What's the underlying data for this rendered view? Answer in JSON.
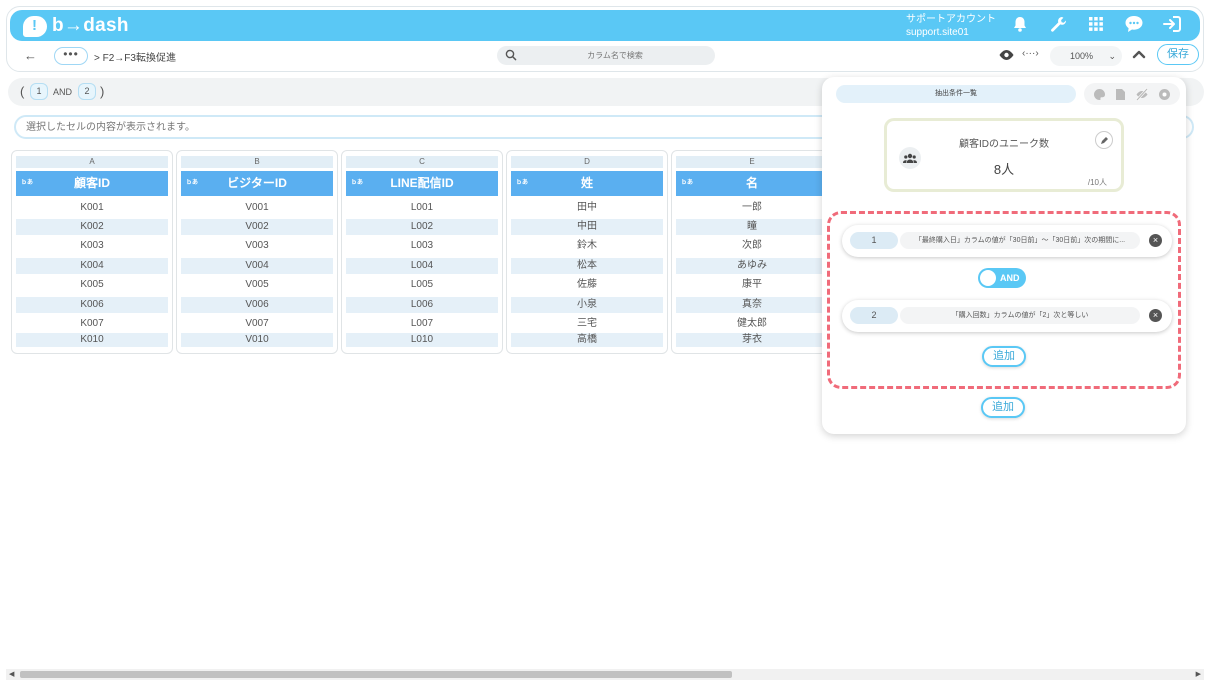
{
  "header": {
    "brand": "b→dash",
    "account_line1": "サポートアカウント",
    "account_line2": "support.site01",
    "icons": [
      "bell-icon",
      "wrench-icon",
      "grid-icon",
      "chat-icon",
      "logout-icon"
    ]
  },
  "toolbar": {
    "back": "←",
    "more": "•••",
    "breadcrumb": "> F2→F3転換促進",
    "search_placeholder": "カラム名で検索",
    "code_icon": "‹···›",
    "zoom": "100%",
    "save_label": "保存"
  },
  "conditions_bar": {
    "open": "(",
    "close": ")",
    "first": "1",
    "operator": "AND",
    "second": "2"
  },
  "cell_input_placeholder": "選択したセルの内容が表示されます。",
  "grid": {
    "type_badge": "ｂあ",
    "columns": [
      {
        "letter": "A",
        "header": "顧客ID",
        "cells": [
          "K001",
          "K002",
          "K003",
          "K004",
          "K005",
          "K006",
          "K007",
          "K010"
        ]
      },
      {
        "letter": "B",
        "header": "ビジターID",
        "cells": [
          "V001",
          "V002",
          "V003",
          "V004",
          "V005",
          "V006",
          "V007",
          "V010"
        ]
      },
      {
        "letter": "C",
        "header": "LINE配信ID",
        "cells": [
          "L001",
          "L002",
          "L003",
          "L004",
          "L005",
          "L006",
          "L007",
          "L010"
        ]
      },
      {
        "letter": "D",
        "header": "姓",
        "cells": [
          "田中",
          "中田",
          "鈴木",
          "松本",
          "佐藤",
          "小泉",
          "三宅",
          "高橋"
        ]
      },
      {
        "letter": "E",
        "header": "名",
        "cells": [
          "一郎",
          "瞳",
          "次郎",
          "あゆみ",
          "康平",
          "真奈",
          "健太郎",
          "芽衣"
        ]
      }
    ]
  },
  "panel": {
    "title": "抽出条件一覧",
    "summary_label": "顧客IDのユニーク数",
    "summary_value": "8人",
    "summary_total": "/10人",
    "conditions": [
      {
        "num": "1",
        "text": "「最終購入日」カラムの値が「30日前」～「30日前」次の期間に..."
      },
      {
        "num": "2",
        "text": "「購入回数」カラムの値が「2」次と等しい"
      }
    ],
    "toggle_label": "AND",
    "add_inner": "追加",
    "add_outer": "追加"
  },
  "colors": {
    "brand": "#5ac8f5",
    "header_cell": "#5aaff0",
    "alt_row": "#e5f0f8",
    "highlight_dash": "#f06b7a"
  }
}
